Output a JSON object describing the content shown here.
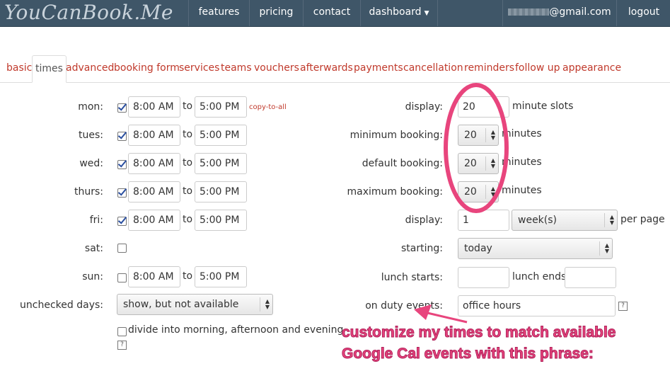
{
  "header": {
    "logo": "YouCanBook.Me",
    "nav": [
      "features",
      "pricing",
      "contact"
    ],
    "dashboard": "dashboard",
    "user_email": "@gmail.com",
    "logout": "logout"
  },
  "tabs": [
    "basic",
    "times",
    "advanced",
    "booking form",
    "services",
    "teams",
    "vouchers",
    "afterwards",
    "payments",
    "cancellation",
    "reminders",
    "follow up",
    "appearance"
  ],
  "days": [
    {
      "label": "mon:",
      "checked": true,
      "start": "8:00 AM",
      "to": "to",
      "end": "5:00 PM"
    },
    {
      "label": "tues:",
      "checked": true,
      "start": "8:00 AM",
      "to": "to",
      "end": "5:00 PM"
    },
    {
      "label": "wed:",
      "checked": true,
      "start": "8:00 AM",
      "to": "to",
      "end": "5:00 PM"
    },
    {
      "label": "thurs:",
      "checked": true,
      "start": "8:00 AM",
      "to": "to",
      "end": "5:00 PM"
    },
    {
      "label": "fri:",
      "checked": true,
      "start": "8:00 AM",
      "to": "to",
      "end": "5:00 PM"
    },
    {
      "label": "sat:",
      "checked": false
    },
    {
      "label": "sun:",
      "checked": false,
      "start": "8:00 AM",
      "to": "to",
      "end": "5:00 PM"
    }
  ],
  "copy_to_all": "copy-to-all",
  "unchecked_days": {
    "label": "unchecked days:",
    "value": "show, but not available"
  },
  "divide": {
    "checked": false,
    "label": "divide into morning, afternoon and evening",
    "help": "?"
  },
  "right": {
    "display_slots": {
      "label": "display:",
      "value": "20",
      "suffix": "minute slots"
    },
    "min_booking": {
      "label": "minimum booking:",
      "value": "20",
      "suffix": "minutes"
    },
    "default_booking": {
      "label": "default booking:",
      "value": "20",
      "suffix": "minutes"
    },
    "max_booking": {
      "label": "maximum booking:",
      "value": "20",
      "suffix": "minutes"
    },
    "display_pages": {
      "label": "display:",
      "value": "1",
      "unit": "week(s)",
      "suffix": "per page"
    },
    "starting": {
      "label": "starting:",
      "value": "today"
    },
    "lunch": {
      "label": "lunch starts:",
      "value": "",
      "end_label": "lunch ends:",
      "end_value": ""
    },
    "on_duty": {
      "label": "on duty events:",
      "value": "office hours",
      "help": "?"
    }
  },
  "annotation": {
    "line1": "customize my times to match available",
    "line2": "Google Cal events with this phrase:",
    "color": "#e8457d"
  }
}
